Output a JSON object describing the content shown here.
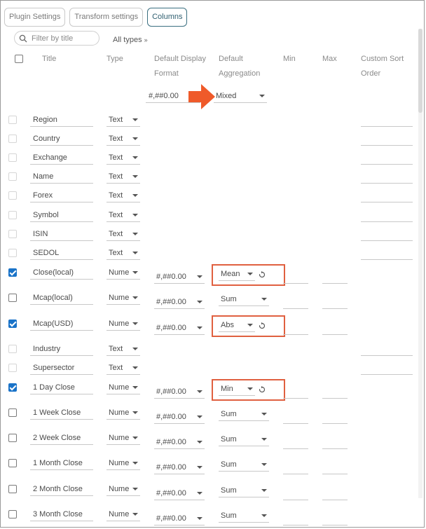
{
  "tabs": [
    {
      "label": "Plugin Settings",
      "active": false
    },
    {
      "label": "Transform settings",
      "active": false
    },
    {
      "label": "Columns",
      "active": true
    }
  ],
  "filter": {
    "placeholder": "Filter by title",
    "icon": "search-icon"
  },
  "type_filter": {
    "label": "All types",
    "icon": "double-chevron-down-icon"
  },
  "headers": {
    "title": "Title",
    "type": "Type",
    "format_line1": "Default Display",
    "format_line2": "Format",
    "agg_line1": "Default",
    "agg_line2": "Aggregation",
    "min": "Min",
    "max": "Max",
    "sort_line1": "Custom Sort",
    "sort_line2": "Order"
  },
  "bulk": {
    "format": "#,##0.00",
    "aggregation": "Mixed"
  },
  "rows": [
    {
      "title": "Region",
      "type": "Text",
      "checked": false,
      "enabled": false
    },
    {
      "title": "Country",
      "type": "Text",
      "checked": false,
      "enabled": false
    },
    {
      "title": "Exchange",
      "type": "Text",
      "checked": false,
      "enabled": false
    },
    {
      "title": "Name",
      "type": "Text",
      "checked": false,
      "enabled": false
    },
    {
      "title": "Forex",
      "type": "Text",
      "checked": false,
      "enabled": false
    },
    {
      "title": "Symbol",
      "type": "Text",
      "checked": false,
      "enabled": false
    },
    {
      "title": "ISIN",
      "type": "Text",
      "checked": false,
      "enabled": false
    },
    {
      "title": "SEDOL",
      "type": "Text",
      "checked": false,
      "enabled": false
    },
    {
      "title": "Close(local)",
      "type": "Nume",
      "checked": true,
      "enabled": true,
      "format": "#,##0.00",
      "aggregation": "Mean",
      "highlighted": true
    },
    {
      "title": "Mcap(local)",
      "type": "Nume",
      "checked": false,
      "enabled": true,
      "format": "#,##0.00",
      "aggregation": "Sum"
    },
    {
      "title": "Mcap(USD)",
      "type": "Nume",
      "checked": true,
      "enabled": true,
      "format": "#,##0.00",
      "aggregation": "Abs",
      "highlighted": true
    },
    {
      "title": "Industry",
      "type": "Text",
      "checked": false,
      "enabled": false
    },
    {
      "title": "Supersector",
      "type": "Text",
      "checked": false,
      "enabled": false
    },
    {
      "title": "1 Day Close",
      "type": "Nume",
      "checked": true,
      "enabled": true,
      "format": "#,##0.00",
      "aggregation": "Min",
      "highlighted": true
    },
    {
      "title": "1 Week Close",
      "type": "Nume",
      "checked": false,
      "enabled": true,
      "format": "#,##0.00",
      "aggregation": "Sum"
    },
    {
      "title": "2 Week Close",
      "type": "Nume",
      "checked": false,
      "enabled": true,
      "format": "#,##0.00",
      "aggregation": "Sum"
    },
    {
      "title": "1 Month Close",
      "type": "Nume",
      "checked": false,
      "enabled": true,
      "format": "#,##0.00",
      "aggregation": "Sum"
    },
    {
      "title": "2 Month Close",
      "type": "Nume",
      "checked": false,
      "enabled": true,
      "format": "#,##0.00",
      "aggregation": "Sum"
    },
    {
      "title": "3 Month Close",
      "type": "Nume",
      "checked": false,
      "enabled": true,
      "format": "#,##0.00",
      "aggregation": "Sum"
    }
  ],
  "colors": {
    "accent": "#1a73c8",
    "highlight": "#e06040",
    "active_tab": "#2f5f70"
  }
}
